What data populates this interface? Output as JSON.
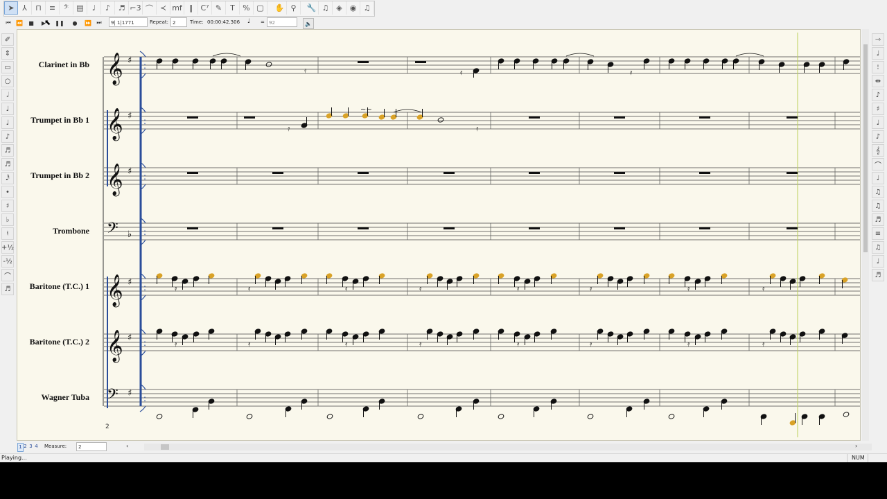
{
  "toolbar_top": {
    "tools": [
      {
        "name": "select-arrow-icon",
        "glyph": "➤",
        "selected": true
      },
      {
        "name": "up-bow-icon",
        "glyph": "⅄"
      },
      {
        "name": "down-bow-icon",
        "glyph": "⊓"
      },
      {
        "name": "staff-icon",
        "glyph": "≡"
      },
      {
        "name": "bass-clef-icon",
        "glyph": "𝄢"
      },
      {
        "name": "keyboard-icon",
        "glyph": "▤"
      },
      {
        "name": "quarter-note-icon",
        "glyph": "♩"
      },
      {
        "name": "eighth-note-icon",
        "glyph": "♪"
      },
      {
        "name": "beam-icon",
        "glyph": "♬"
      },
      {
        "name": "tuplet-icon",
        "glyph": "⌐3"
      },
      {
        "name": "slur-icon",
        "glyph": "⌒"
      },
      {
        "name": "hairpin-icon",
        "glyph": "≺"
      },
      {
        "name": "dynamics-icon",
        "glyph": "mf"
      },
      {
        "name": "barline-icon",
        "glyph": "‖"
      },
      {
        "name": "chord-icon",
        "glyph": "C⁷"
      },
      {
        "name": "pen-icon",
        "glyph": "✎"
      },
      {
        "name": "text-icon",
        "glyph": "T"
      },
      {
        "name": "percent-icon",
        "glyph": "%"
      },
      {
        "name": "page-icon",
        "glyph": "▢"
      },
      {
        "name": "hand-icon",
        "glyph": "✋"
      },
      {
        "name": "zoom-icon",
        "glyph": "⚲"
      },
      {
        "name": "wrench-icon",
        "glyph": "🔧"
      },
      {
        "name": "music-notes-icon",
        "glyph": "♫"
      },
      {
        "name": "eraser-icon",
        "glyph": "◈"
      },
      {
        "name": "palette-icon",
        "glyph": "◉"
      },
      {
        "name": "score-view-icon",
        "glyph": "♫"
      }
    ]
  },
  "playback": {
    "position": "9| 1|1771",
    "repeat_label": "Repeat:",
    "repeat_value": "2",
    "time_label": "Time:",
    "time_value": "00:00:42.306",
    "tempo_note": "♩",
    "tempo_equals": "=",
    "tempo_value": "92"
  },
  "left_palette": [
    "✐",
    "⇕",
    "▭",
    "○",
    "𝅗𝅥",
    "♩",
    "♩",
    "♪",
    "♬",
    "♬",
    "𝅘𝅥𝅰",
    "•",
    "♯",
    "♭",
    "♮",
    "+½",
    "-½",
    "⌒",
    "♬"
  ],
  "right_palette": [
    "⇾",
    "♩",
    "⁝",
    "⇹",
    "♪",
    "♯",
    "♩",
    "♪",
    "𝄞",
    "⌒",
    "♩",
    "♫",
    "♫",
    "♬",
    "≡",
    "♫",
    "♩",
    "♬"
  ],
  "score": {
    "instruments": [
      {
        "name": "Clarinet in Bb",
        "clef": "treble",
        "key": "♯"
      },
      {
        "name": "Trumpet in Bb 1",
        "clef": "treble",
        "key": "♯"
      },
      {
        "name": "Trumpet in Bb 2",
        "clef": "treble",
        "key": "♯"
      },
      {
        "name": "Trombone",
        "clef": "bass",
        "key": "♭"
      },
      {
        "name": "Baritone (T.C.) 1",
        "clef": "treble",
        "key": "♯"
      },
      {
        "name": "Baritone (T.C.) 2",
        "clef": "treble",
        "key": "♯"
      },
      {
        "name": "Wagner Tuba",
        "clef": "bass",
        "key": "♯"
      }
    ],
    "system_number": "2"
  },
  "bottom": {
    "pages": [
      "1",
      "2",
      "3",
      "4"
    ],
    "measure_label": "Measure:",
    "measure_value": "2"
  },
  "status": {
    "text": "Playing...",
    "num": "NUM"
  },
  "colors": {
    "paper": "#faf8ec",
    "highlight_note": "#d9a227",
    "barline_blue": "#2a4d9a",
    "playhead": "#bcd15a"
  }
}
